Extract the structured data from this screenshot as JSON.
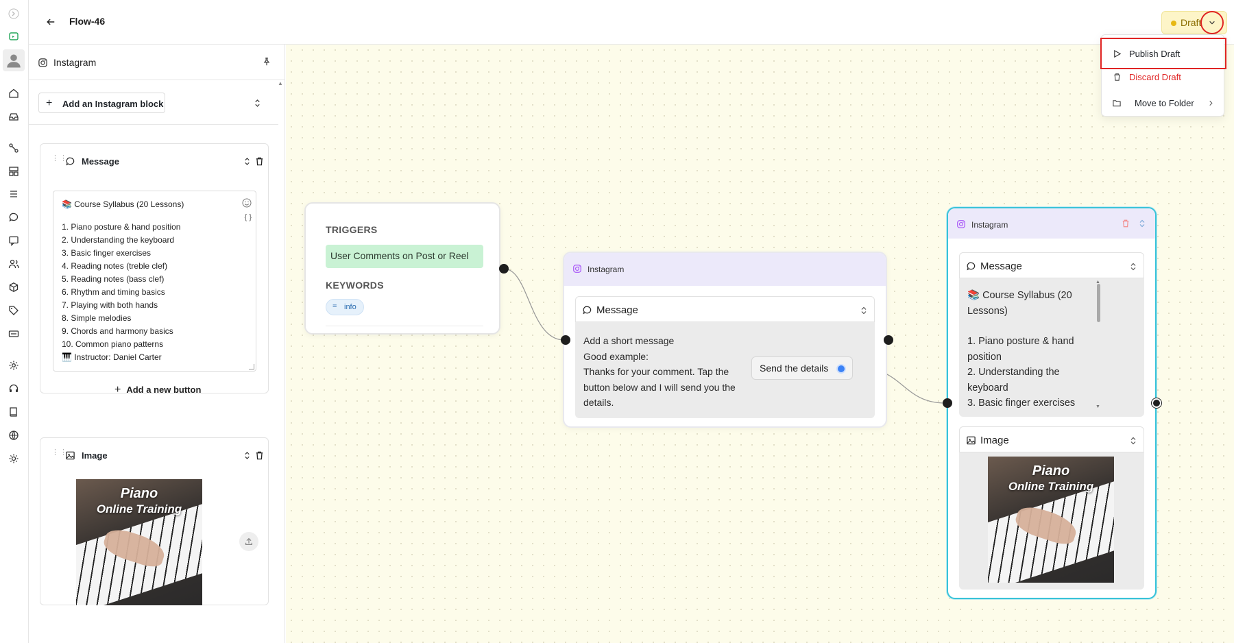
{
  "header": {
    "title": "Flow-46",
    "status": "Draft"
  },
  "menu": {
    "publish": "Publish Draft",
    "discard": "Discard Draft",
    "move": "Move to Folder"
  },
  "sidebar": {
    "channel": "Instagram",
    "add_block": "Add an Instagram block",
    "message_card": {
      "title": "Message",
      "lines": [
        "📚 Course Syllabus (20 Lessons)",
        "",
        "1. Piano posture & hand position",
        "2. Understanding the keyboard",
        "3. Basic finger exercises",
        "4. Reading notes (treble clef)",
        "5. Reading notes (bass clef)",
        "6. Rhythm and timing basics",
        "7. Playing with both hands",
        "8. Simple melodies",
        "9. Chords and harmony basics",
        "10. Common piano patterns",
        "🎹 Instructor: Daniel Carter"
      ],
      "vars_label": "{ }",
      "add_button": "Add a new button"
    },
    "image_card": {
      "title": "Image",
      "image_text_1": "Piano",
      "image_text_2": "Online Training"
    }
  },
  "canvas": {
    "triggers_node": {
      "triggers_label": "TRIGGERS",
      "trigger": "User Comments on Post or Reel",
      "keywords_label": "KEYWORDS",
      "keyword": "info"
    },
    "ig_node_1": {
      "channel": "Instagram",
      "block_title": "Message",
      "lines": [
        "Add a short message",
        "Good example:",
        "Thanks for your comment. Tap the button below and I will send you the details."
      ],
      "button": "Send the details"
    },
    "ig_node_2": {
      "channel": "Instagram",
      "message_title": "Message",
      "message_lines": [
        "📚 Course Syllabus (20 Lessons)",
        "",
        "1. Piano posture & hand position",
        "2. Understanding the keyboard",
        "3. Basic finger exercises"
      ],
      "image_title": "Image",
      "image_text_1": "Piano",
      "image_text_2": "Online Training"
    }
  },
  "colors": {
    "accent_red": "#e02424",
    "trigger_green": "#c9f2d4",
    "node_header": "#ece9fa",
    "selected_border": "#38c3d8",
    "draft_yellow": "#fdf5c8"
  }
}
